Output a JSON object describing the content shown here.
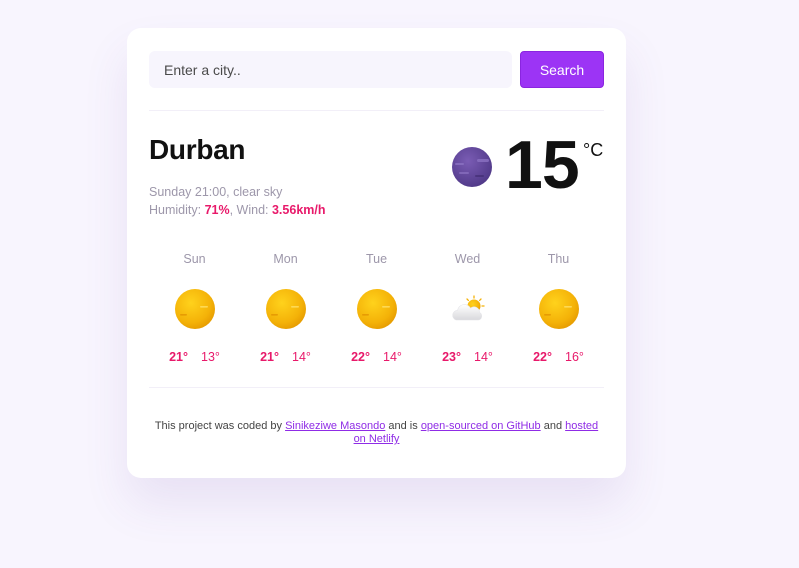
{
  "search": {
    "placeholder": "Enter a city..",
    "button_label": "Search"
  },
  "current": {
    "city": "Durban",
    "datetime_desc": "Sunday 21:00, clear sky",
    "humidity_label": "Humidity: ",
    "humidity_value": "71%",
    "wind_label": ", Wind: ",
    "wind_value": "3.56km/h",
    "temperature": "15",
    "unit": "°C",
    "icon": "clear-night-moon-icon"
  },
  "forecast": [
    {
      "day": "Sun",
      "max": "21°",
      "min": "13°",
      "icon": "sun-icon"
    },
    {
      "day": "Mon",
      "max": "21°",
      "min": "14°",
      "icon": "sun-icon"
    },
    {
      "day": "Tue",
      "max": "22°",
      "min": "14°",
      "icon": "sun-icon"
    },
    {
      "day": "Wed",
      "max": "23°",
      "min": "14°",
      "icon": "partly-cloudy-icon"
    },
    {
      "day": "Thu",
      "max": "22°",
      "min": "16°",
      "icon": "sun-icon"
    }
  ],
  "footer": {
    "text_1": "This project was coded by ",
    "author_link": "Sinikeziwe Masondo",
    "text_2": " and is ",
    "github_link": "open-sourced on GitHub",
    "text_3": " and ",
    "hosting_link": "hosted on Netlify"
  },
  "colors": {
    "accent": "#9c34f5",
    "highlight": "#e8196a",
    "background": "#f8f5fe"
  }
}
